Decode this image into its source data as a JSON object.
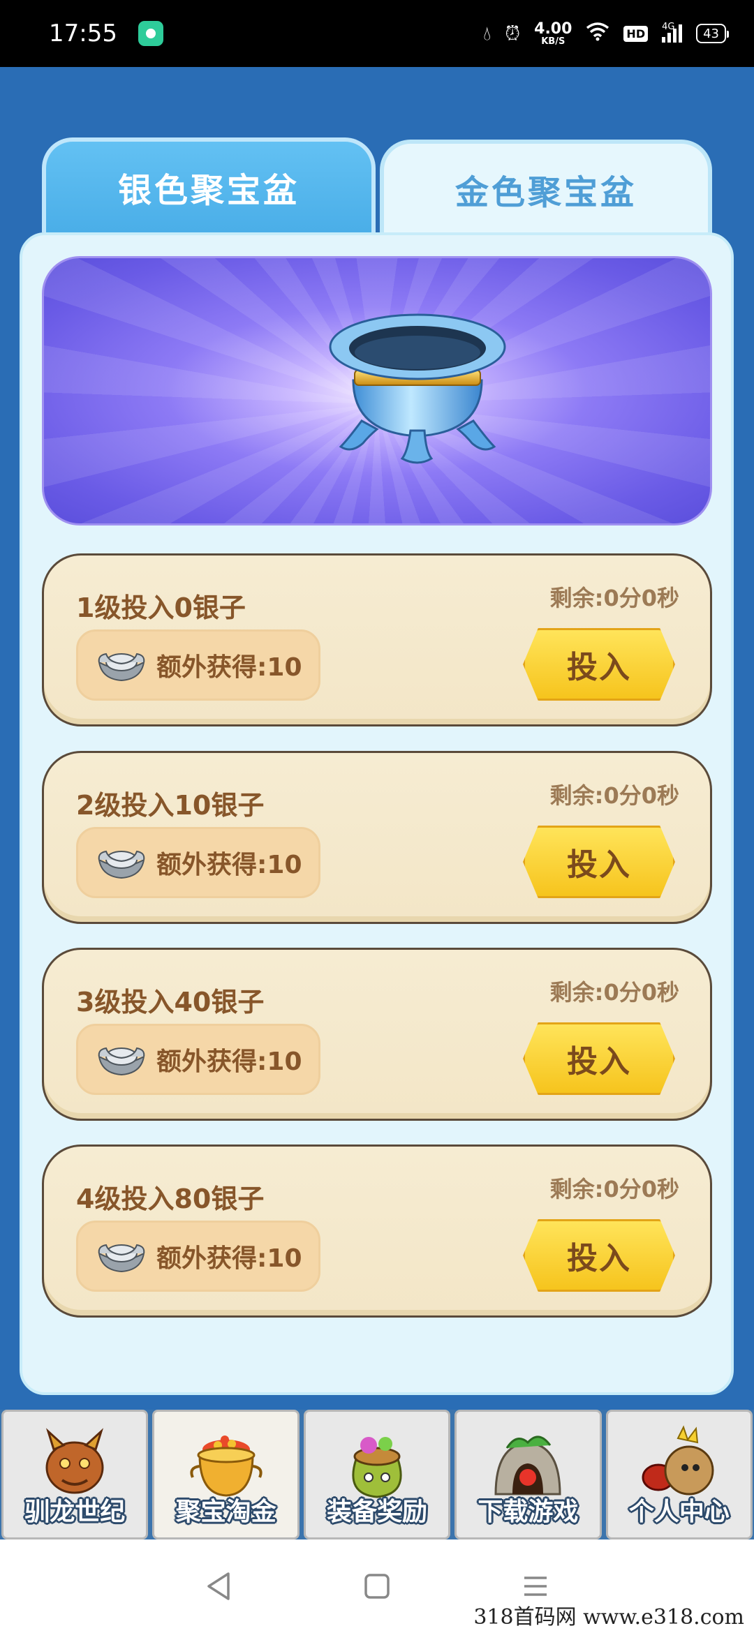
{
  "status_bar": {
    "time": "17:55",
    "speed_value": "4.00",
    "speed_unit": "KB/S",
    "hd": "HD",
    "network": "4G",
    "battery": "43"
  },
  "tabs": [
    {
      "label": "银色聚宝盆",
      "active": true
    },
    {
      "label": "金色聚宝盆",
      "active": false
    }
  ],
  "banner": {
    "icon": "silver-treasure-pot-icon"
  },
  "rows": [
    {
      "title": "1级投入0银子",
      "remaining": "剩余:0分0秒",
      "bonus": "额外获得:10",
      "button": "投入"
    },
    {
      "title": "2级投入10银子",
      "remaining": "剩余:0分0秒",
      "bonus": "额外获得:10",
      "button": "投入"
    },
    {
      "title": "3级投入40银子",
      "remaining": "剩余:0分0秒",
      "bonus": "额外获得:10",
      "button": "投入"
    },
    {
      "title": "4级投入80银子",
      "remaining": "剩余:0分0秒",
      "bonus": "额外获得:10",
      "button": "投入"
    }
  ],
  "bottom_nav": [
    {
      "label": "驯龙世纪",
      "icon": "dragon-icon"
    },
    {
      "label": "聚宝淘金",
      "icon": "gold-pot-icon",
      "active": true
    },
    {
      "label": "装备奖励",
      "icon": "reward-bag-icon"
    },
    {
      "label": "下载游戏",
      "icon": "download-cave-icon"
    },
    {
      "label": "个人中心",
      "icon": "profile-icon"
    }
  ],
  "watermark": "318首码网 www.e318.com",
  "colors": {
    "background": "#2a6db5",
    "active_tab": "#4aaee8",
    "button": "#f6c41d",
    "text_brown": "#87562a"
  }
}
